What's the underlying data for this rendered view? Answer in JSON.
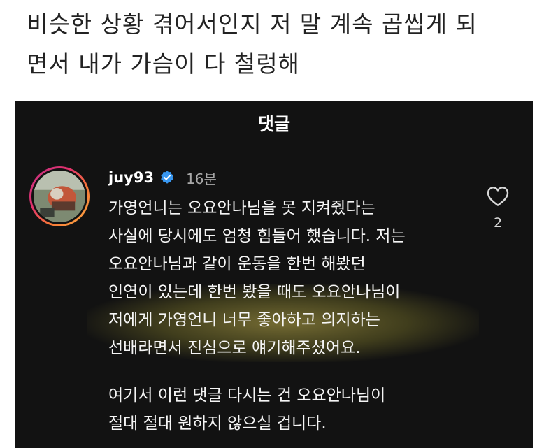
{
  "post": {
    "caption_lines": [
      "비슷한 상황 겪어서인지 저 말 계속 곱씹게 되",
      "면서 내가 가슴이 다 철렁해"
    ]
  },
  "comments_sheet": {
    "title": "댓글",
    "background": "#121212",
    "comment": {
      "username": "juy93",
      "verified_icon": "verified-badge-icon",
      "verified_color": "#3897f0",
      "timestamp": "16분",
      "like_icon": "heart-outline-icon",
      "like_count": "2",
      "paragraph1": {
        "lines": [
          "가영언니는 오요안나님을 못 지켜줬다는",
          "사실에 당시에도 엄청 힘들어 했습니다. 저는",
          "오요안나님과 같이 운동을 한번 해봤던",
          "인연이 있는데 한번 봤을 때도 오요안나님이",
          "저에게 가영언니 너무 좋아하고 의지하는",
          "선배라면서 진심으로 얘기해주셨어요."
        ]
      },
      "paragraph2": {
        "lines": [
          "여기서 이런 댓글 다시는 건 오요안나님이",
          "절대 절대 원하지 않으실 겁니다."
        ]
      },
      "highlight_color": "#e8d65a"
    }
  }
}
